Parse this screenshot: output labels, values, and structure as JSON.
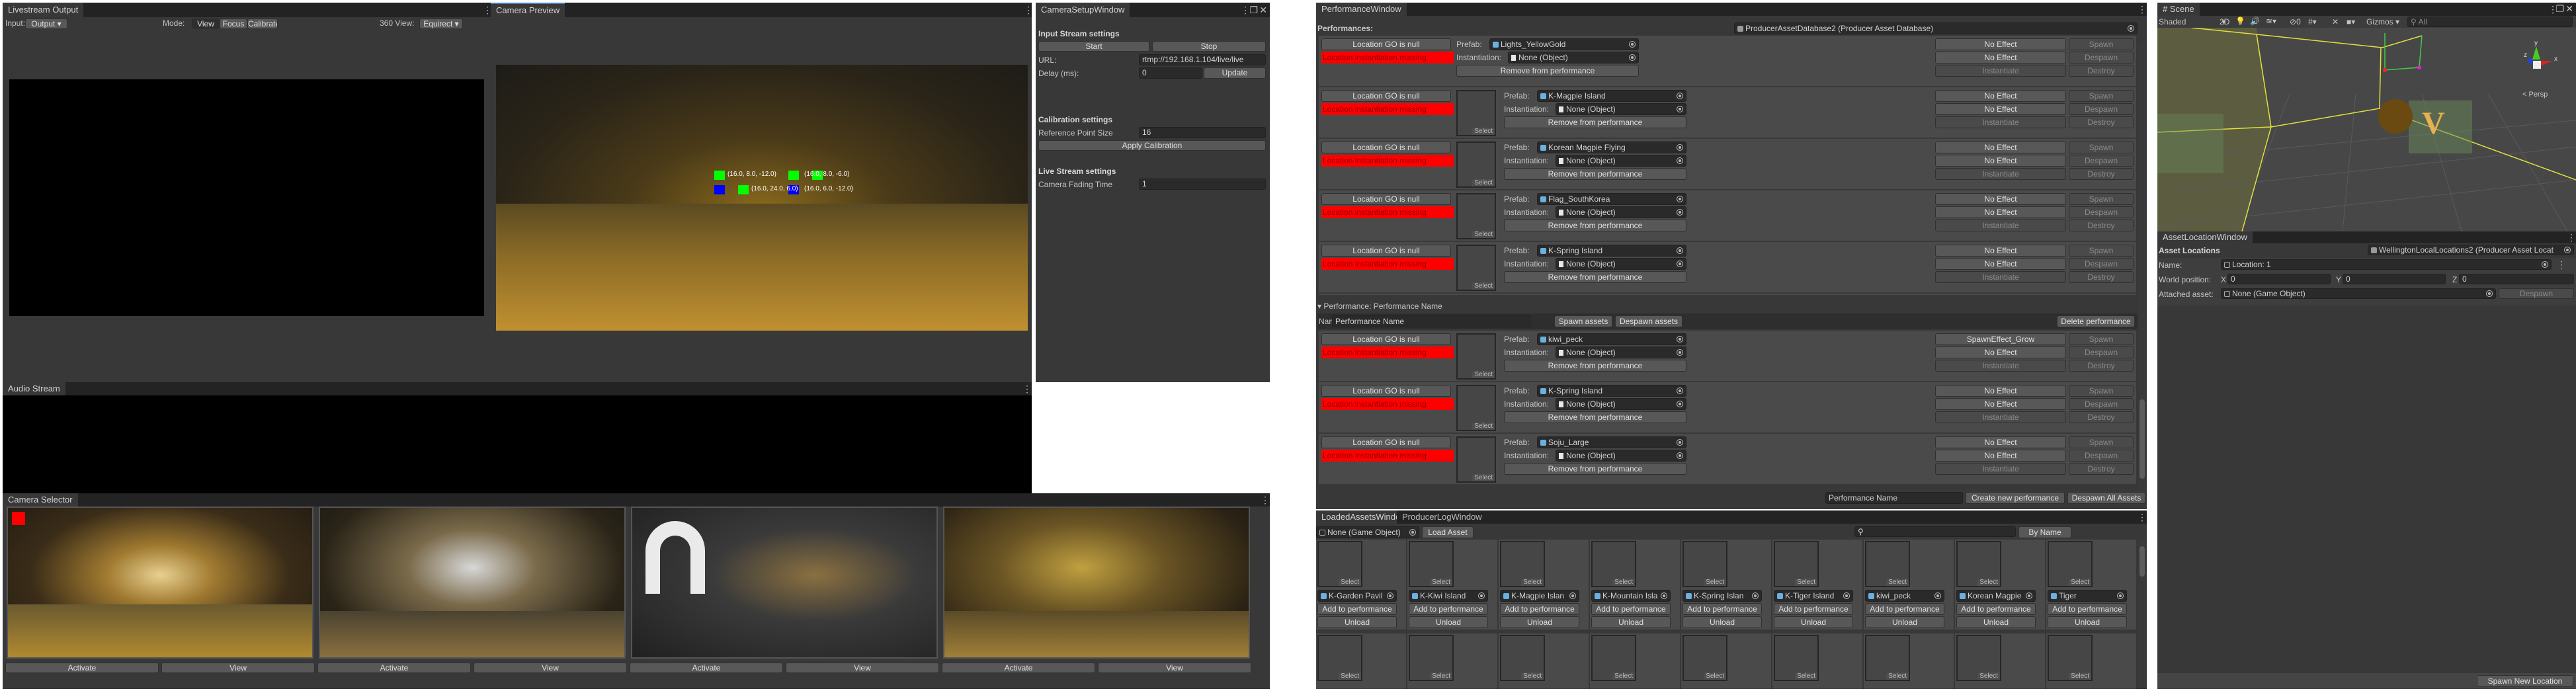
{
  "livestream": {
    "tab": "Livestream Output",
    "input_label": "Input:",
    "input_value": "Output",
    "mode_label": "Mode:",
    "modes": [
      "View",
      "Focus",
      "Calibrate"
    ],
    "view360_label": "360 View:",
    "view360_value": "Equirect"
  },
  "camera_preview": {
    "tab": "Camera Preview",
    "labels": [
      "(16.0, 8.0, -12.0)",
      "(16.0, 6.0, -12.0)",
      "(16.0, 24.0, 6.0)",
      "(16.0, 8.0, -6.0)",
      "(16.0, 6.0, -12.0)"
    ]
  },
  "camera_setup": {
    "tab": "CameraSetupWindow",
    "input_stream_title": "Input Stream settings",
    "start": "Start",
    "stop": "Stop",
    "url_label": "URL:",
    "url_value": "rtmp://192.168.1.104/live/live",
    "delay_label": "Delay (ms):",
    "delay_value": "0",
    "update": "Update",
    "calibration_title": "Calibration settings",
    "ref_point_label": "Reference Point Size",
    "ref_point_value": "16",
    "apply_calibration": "Apply Calibration",
    "live_stream_title": "Live Stream settings",
    "fading_label": "Camera Fading Time",
    "fading_value": "1"
  },
  "audio_stream": {
    "tab": "Audio Stream"
  },
  "camera_selector": {
    "tab": "Camera Selector",
    "cameras": [
      {
        "activate": "Activate",
        "view": "View",
        "active": true
      },
      {
        "activate": "Activate",
        "view": "View",
        "active": false
      },
      {
        "activate": "Activate",
        "view": "View",
        "active": false
      },
      {
        "activate": "Activate",
        "view": "View",
        "active": false
      }
    ]
  },
  "performance": {
    "tab": "PerformanceWindow",
    "performances_label": "Performances:",
    "database": "ProducerAssetDatabase2 (Producer Asset Database)",
    "location_null": "Location GO is null",
    "location_missing": "Location instantiation missing",
    "prefab_label": "Prefab:",
    "instantiation_label": "Instantiation:",
    "none_object": "None (Object)",
    "remove": "Remove from performance",
    "select": "Select",
    "spawn": "Spawn",
    "despawn": "Despawn",
    "instantiate": "Instantiate",
    "destroy": "Destroy",
    "group1": [
      {
        "prefab": "Lights_YellowGold",
        "effect1": "No Effect",
        "effect2": "No Effect",
        "thumb": false
      },
      {
        "prefab": "K-Magpie Island",
        "effect1": "No Effect",
        "effect2": "No Effect",
        "thumb": true
      },
      {
        "prefab": "Korean Magpie Flying",
        "effect1": "No Effect",
        "effect2": "No Effect",
        "thumb": true
      },
      {
        "prefab": "Flag_SouthKorea",
        "effect1": "No Effect",
        "effect2": "No Effect",
        "thumb": true
      },
      {
        "prefab": "K-Spring Island",
        "effect1": "No Effect",
        "effect2": "No Effect",
        "thumb": true
      }
    ],
    "group2_header": "Performance: Performance Name",
    "name_label": "Name:",
    "name_value": "Performance Name",
    "spawn_assets": "Spawn assets",
    "despawn_assets": "Despawn assets",
    "delete_performance": "Delete performance",
    "group2": [
      {
        "prefab": "kiwi_peck",
        "effect1": "SpawnEffect_Grow",
        "effect2": "No Effect",
        "thumb": true
      },
      {
        "prefab": "K-Spring Island",
        "effect1": "No Effect",
        "effect2": "No Effect",
        "thumb": true
      },
      {
        "prefab": "Soju_Large",
        "effect1": "No Effect",
        "effect2": "No Effect",
        "thumb": true
      }
    ],
    "new_name_value": "Performance Name",
    "create_new": "Create new performance",
    "despawn_all": "Despawn All Assets"
  },
  "loaded_assets": {
    "tab": "LoadedAssetsWindow",
    "tab2": "ProducerLogWindow",
    "object_field": "None (Game Object)",
    "load_asset": "Load Asset",
    "search_placeholder": "",
    "sort": "By Name",
    "add": "Add to performance",
    "unload": "Unload",
    "select": "Select",
    "assets": [
      "K-Garden Pavil",
      "K-Kiwi Island",
      "K-Magpie Islan",
      "K-Mountain Isla",
      "K-Spring Islan",
      "K-Tiger Island",
      "kiwi_peck",
      "Korean Magpie",
      "Tiger"
    ]
  },
  "scene": {
    "tab": "# Scene",
    "shading": "Shaded",
    "mode2d": "2D",
    "hidden_count": "0",
    "gizmos": "Gizmos",
    "search_placeholder": "All",
    "persp": "< Persp",
    "axes": [
      "y",
      "x",
      "z"
    ]
  },
  "asset_location": {
    "tab": "AssetLocationWindow",
    "title": "Asset Locations",
    "database": "WellingtonLocalLocations2 (Producer Asset Locat",
    "name_label": "Name:",
    "name_value": "Location: 1",
    "world_label": "World position:",
    "x": "0",
    "y": "0",
    "z": "0",
    "attached_label": "Attached asset:",
    "attached_value": "None (Game Object)",
    "despawn": "Despawn",
    "spawn_new": "Spawn New Location"
  }
}
